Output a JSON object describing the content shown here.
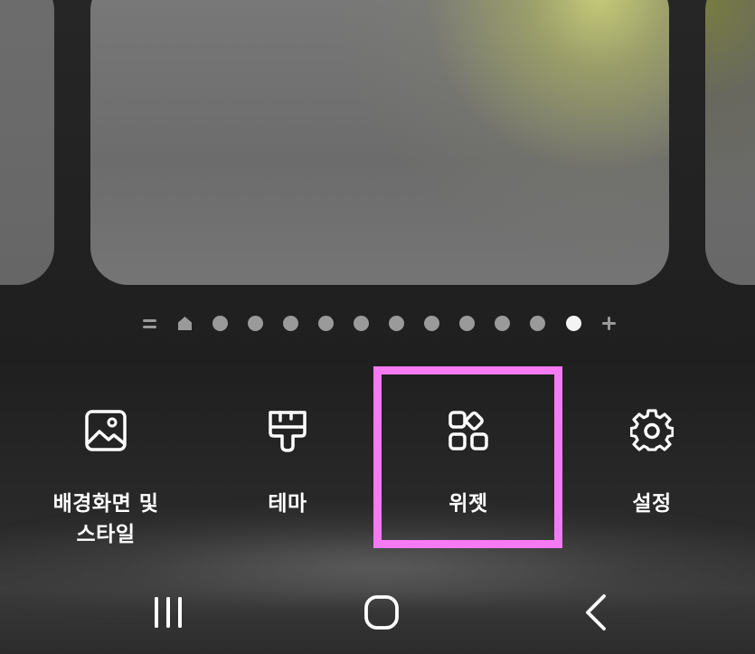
{
  "page_indicator": {
    "icons": [
      "menu-lines-icon",
      "home-icon",
      "plus-icon"
    ],
    "dot_count": 11,
    "active_index": 10
  },
  "menu": {
    "items": [
      {
        "label_line1": "배경화면 및",
        "label_line2": "스타일",
        "icon": "wallpaper-icon"
      },
      {
        "label": "테마",
        "icon": "paintbrush-icon"
      },
      {
        "label": "위젯",
        "icon": "widgets-icon"
      },
      {
        "label": "설정",
        "icon": "gear-icon"
      }
    ],
    "highlighted": "위젯"
  },
  "navigation_bar": {
    "buttons": [
      "recent-apps-icon",
      "home-button-icon",
      "back-icon"
    ]
  },
  "colors": {
    "highlight": "#f57af4",
    "active_dot": "#f4f4f4",
    "inactive_dot": "#9a9a9a",
    "text": "#ffffff"
  }
}
